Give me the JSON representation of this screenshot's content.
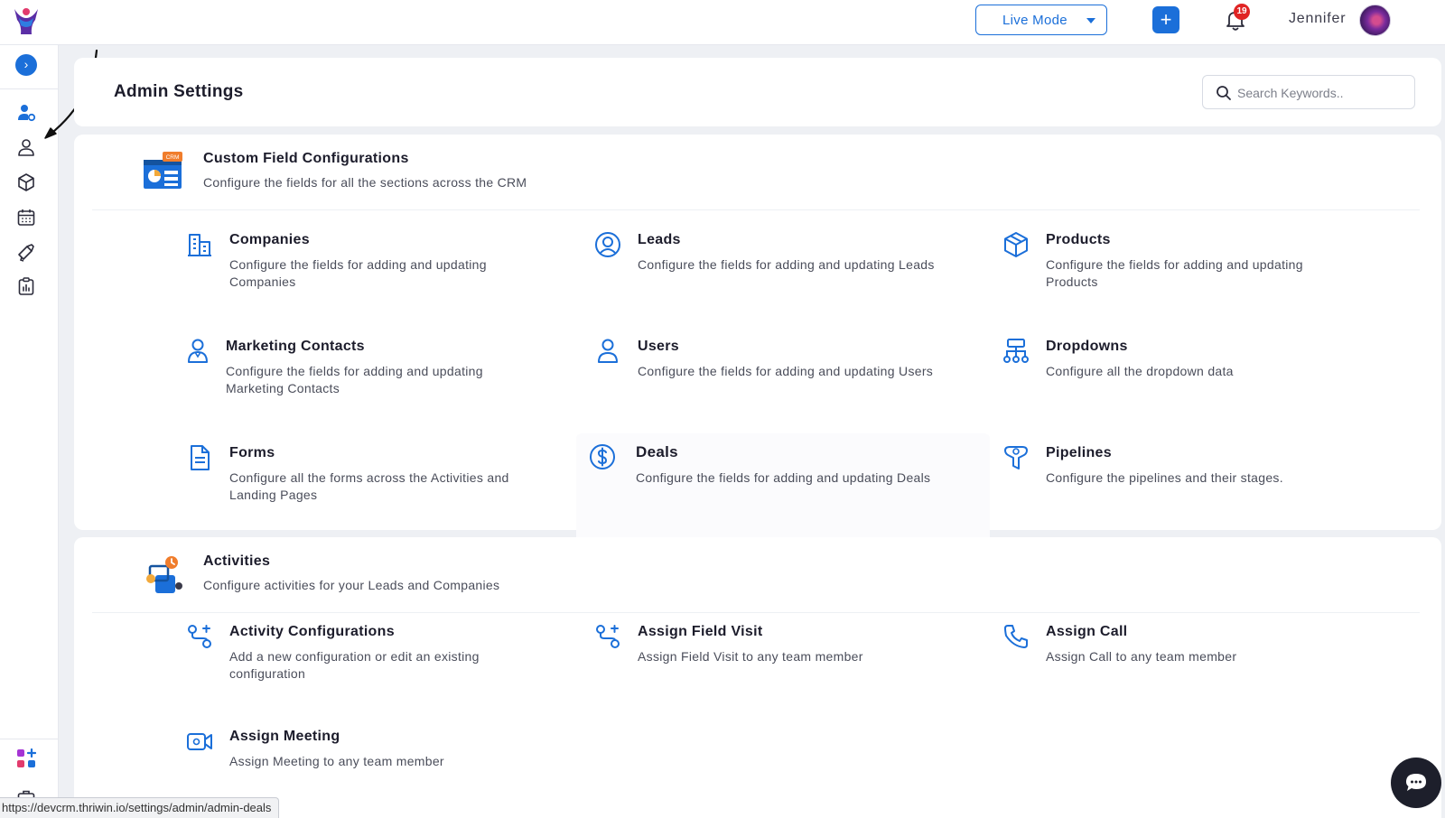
{
  "topbar": {
    "mode_label": "Live Mode",
    "add_label": "+",
    "notification_count": "19",
    "user_name": "Jennifer"
  },
  "sidebar": {
    "expand_label": "›",
    "items": [
      {
        "icon": "user-settings-icon"
      },
      {
        "icon": "user-icon"
      },
      {
        "icon": "cube-icon"
      },
      {
        "icon": "calendar-icon"
      },
      {
        "icon": "megaphone-icon"
      },
      {
        "icon": "clipboard-chart-icon"
      }
    ],
    "bottom_items": [
      {
        "icon": "apps-add-icon"
      },
      {
        "icon": "briefcase-icon"
      }
    ]
  },
  "header": {
    "title": "Admin Settings",
    "search_placeholder": "Search Keywords.."
  },
  "sections": [
    {
      "title": "Custom Field Configurations",
      "desc": "Configure the fields for all the sections across the CRM",
      "badge": "CRM",
      "tiles": [
        {
          "title": "Companies",
          "desc": "Configure the fields for adding and updating Companies",
          "icon": "building-icon"
        },
        {
          "title": "Leads",
          "desc": "Configure the fields for adding and updating Leads",
          "icon": "user-circle-icon"
        },
        {
          "title": "Products",
          "desc": "Configure the fields for adding and updating Products",
          "icon": "box-icon"
        },
        {
          "title": "Marketing Contacts",
          "desc": "Configure the fields for adding and updating Marketing Contacts",
          "icon": "contact-icon"
        },
        {
          "title": "Users",
          "desc": "Configure the fields for adding and updating Users",
          "icon": "user-icon"
        },
        {
          "title": "Dropdowns",
          "desc": "Configure all the dropdown data",
          "icon": "hierarchy-icon"
        },
        {
          "title": "Forms",
          "desc": "Configure all the forms across the Activities and Landing Pages",
          "icon": "document-icon"
        },
        {
          "title": "Deals",
          "desc": "Configure the fields for adding and updating Deals",
          "icon": "dollar-circle-icon"
        },
        {
          "title": "Pipelines",
          "desc": "Configure the pipelines and their stages.",
          "icon": "funnel-icon"
        }
      ]
    },
    {
      "title": "Activities",
      "desc": "Configure activities for your Leads and Companies",
      "tiles": [
        {
          "title": "Activity Configurations",
          "desc": "Add a new configuration or edit an existing configuration",
          "icon": "route-icon"
        },
        {
          "title": "Assign Field Visit",
          "desc": "Assign Field Visit to any team member",
          "icon": "route-icon"
        },
        {
          "title": "Assign Call",
          "desc": "Assign Call to any team member",
          "icon": "phone-icon"
        },
        {
          "title": "Assign Meeting",
          "desc": "Assign Meeting to any team member",
          "icon": "video-icon"
        }
      ]
    }
  ],
  "status_url": "https://devcrm.thriwin.io/settings/admin/admin-deals",
  "colors": {
    "accent": "#1b6fd9",
    "badge": "#e02424",
    "background": "#eef0f4"
  }
}
